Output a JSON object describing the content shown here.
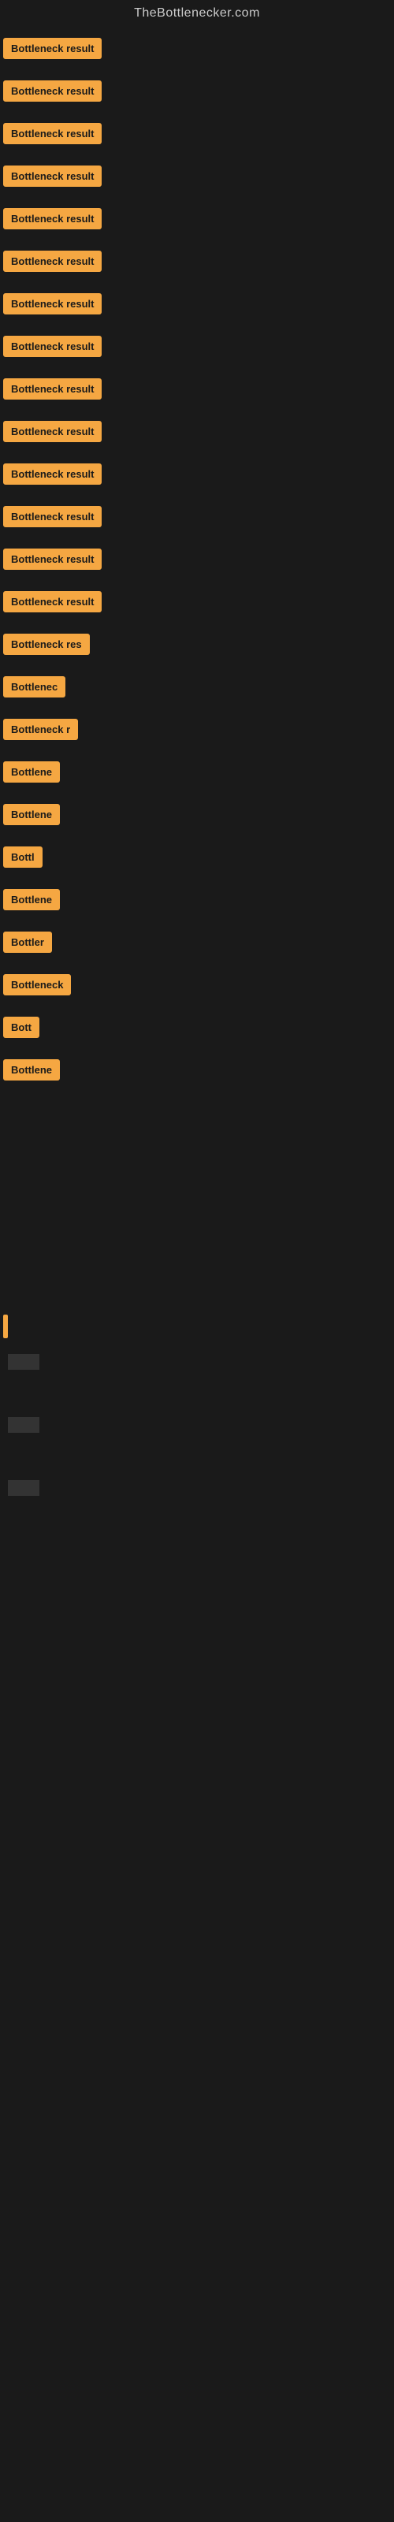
{
  "site": {
    "title": "TheBottlenecker.com"
  },
  "items": [
    {
      "id": 0,
      "label": "Bottleneck result",
      "truncated": "Bottleneck result"
    },
    {
      "id": 1,
      "label": "Bottleneck result",
      "truncated": "Bottleneck result"
    },
    {
      "id": 2,
      "label": "Bottleneck result",
      "truncated": "Bottleneck result"
    },
    {
      "id": 3,
      "label": "Bottleneck result",
      "truncated": "Bottleneck result"
    },
    {
      "id": 4,
      "label": "Bottleneck result",
      "truncated": "Bottleneck result"
    },
    {
      "id": 5,
      "label": "Bottleneck result",
      "truncated": "Bottleneck result"
    },
    {
      "id": 6,
      "label": "Bottleneck result",
      "truncated": "Bottleneck result"
    },
    {
      "id": 7,
      "label": "Bottleneck result",
      "truncated": "Bottleneck result"
    },
    {
      "id": 8,
      "label": "Bottleneck result",
      "truncated": "Bottleneck result"
    },
    {
      "id": 9,
      "label": "Bottleneck result",
      "truncated": "Bottleneck result"
    },
    {
      "id": 10,
      "label": "Bottleneck result",
      "truncated": "Bottleneck result"
    },
    {
      "id": 11,
      "label": "Bottleneck result",
      "truncated": "Bottleneck result"
    },
    {
      "id": 12,
      "label": "Bottleneck result",
      "truncated": "Bottleneck result"
    },
    {
      "id": 13,
      "label": "Bottleneck result",
      "truncated": "Bottleneck result"
    },
    {
      "id": 14,
      "label": "Bottleneck result",
      "truncated": "Bottleneck res"
    },
    {
      "id": 15,
      "label": "Bottleneck result",
      "truncated": "Bottlenec"
    },
    {
      "id": 16,
      "label": "Bottleneck result",
      "truncated": "Bottleneck r"
    },
    {
      "id": 17,
      "label": "Bottleneck result",
      "truncated": "Bottlene"
    },
    {
      "id": 18,
      "label": "Bottleneck result",
      "truncated": "Bottlene"
    },
    {
      "id": 19,
      "label": "Bottleneck result",
      "truncated": "Bottl"
    },
    {
      "id": 20,
      "label": "Bottleneck result",
      "truncated": "Bottlene"
    },
    {
      "id": 21,
      "label": "Bottleneck result",
      "truncated": "Bottler"
    },
    {
      "id": 22,
      "label": "Bottleneck result",
      "truncated": "Bottleneck"
    },
    {
      "id": 23,
      "label": "Bottleneck result",
      "truncated": "Bott"
    },
    {
      "id": 24,
      "label": "Bottleneck result",
      "truncated": "Bottlene"
    }
  ],
  "colors": {
    "badge_bg": "#f5a742",
    "badge_text": "#1a1a1a",
    "background": "#1a1a1a",
    "title_text": "#cccccc"
  }
}
